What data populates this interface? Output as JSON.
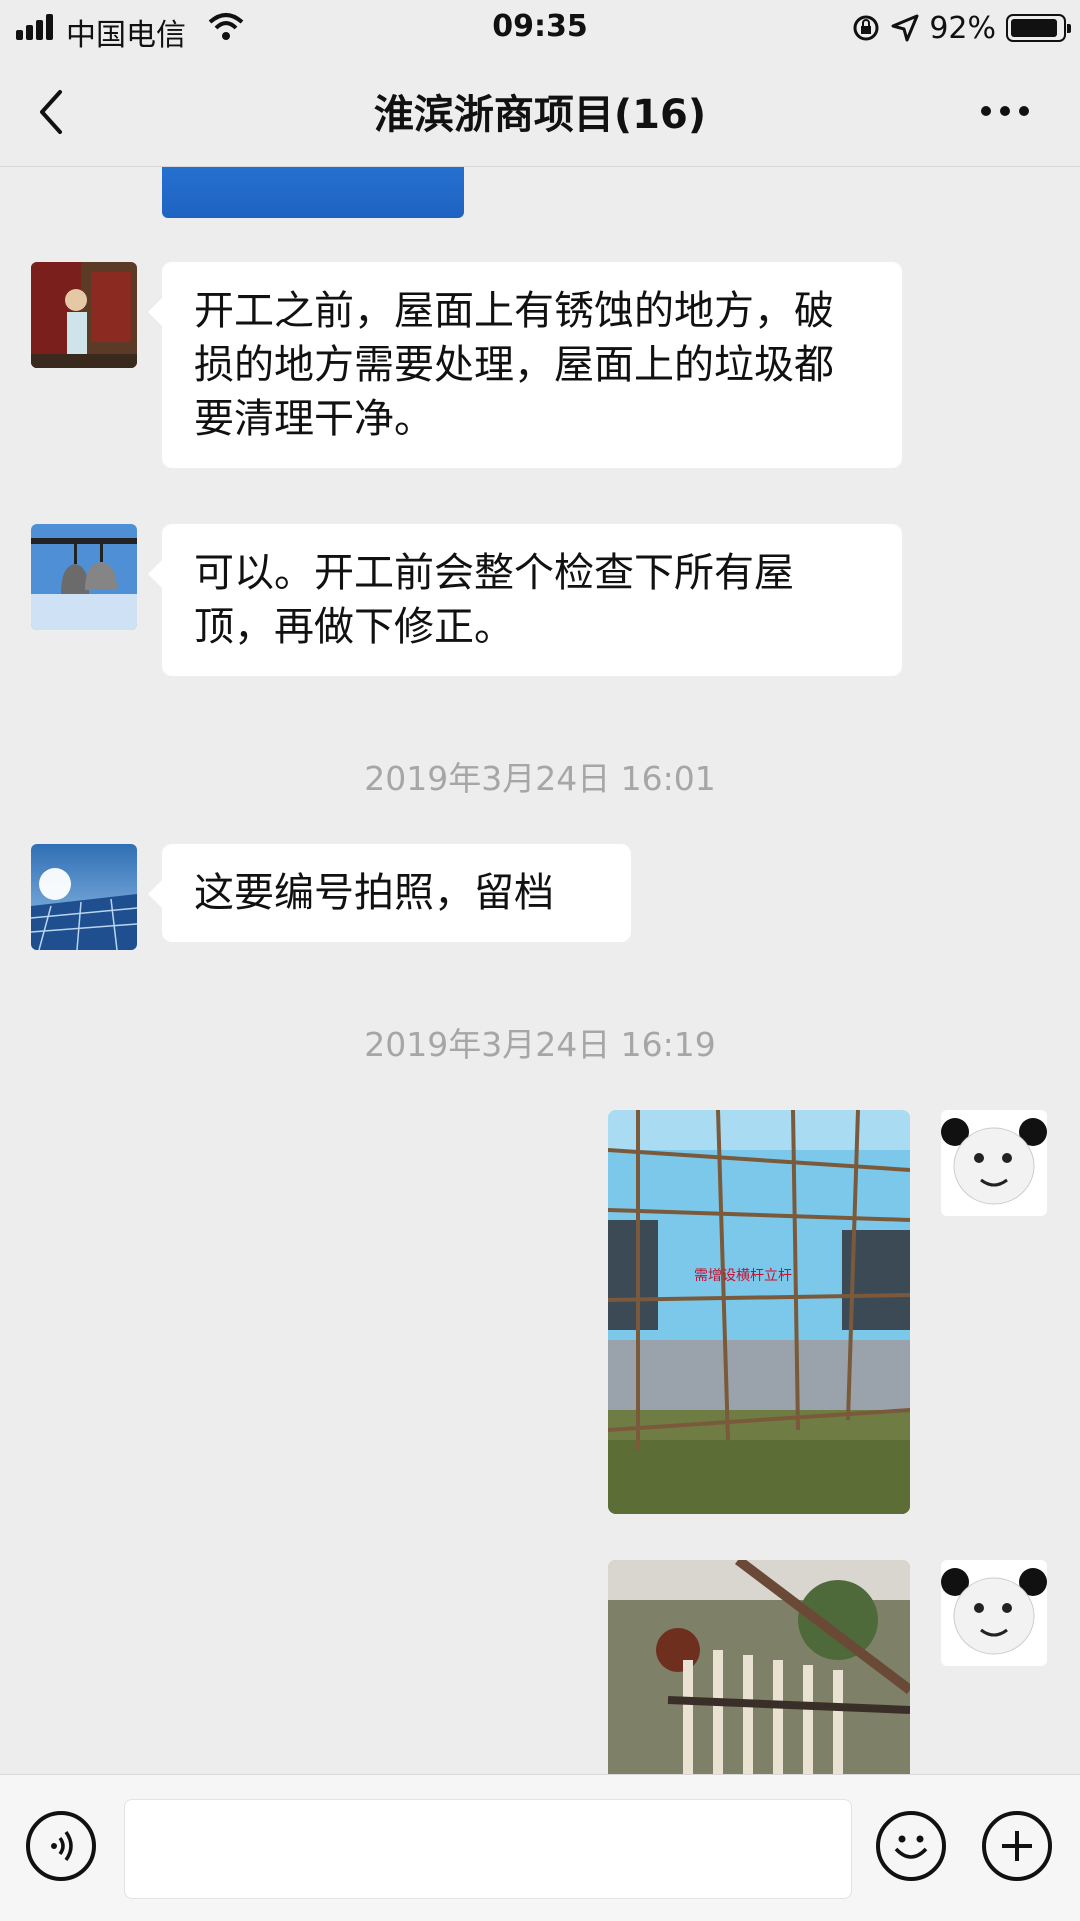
{
  "status_bar": {
    "carrier": "中国电信",
    "time": "09:35",
    "battery_percent": "92%",
    "battery_level": 0.92
  },
  "nav": {
    "title": "淮滨浙商项目(16)"
  },
  "messages": [
    {
      "type": "text",
      "side": "left",
      "text": "开工之前，屋面上有锈蚀的地方，破损的地方需要处理，屋面上的垃圾都要清理干净。"
    },
    {
      "type": "text",
      "side": "left",
      "text": "可以。开工前会整个检查下所有屋顶，再做下修正。"
    },
    {
      "type": "timestamp",
      "text": "2019年3月24日 16:01"
    },
    {
      "type": "text",
      "side": "left",
      "text": "这要编号拍照，留档"
    },
    {
      "type": "timestamp",
      "text": "2019年3月24日 16:19"
    },
    {
      "type": "image",
      "side": "right",
      "caption": "需增设横杆立杆"
    },
    {
      "type": "image",
      "side": "right",
      "caption": ""
    }
  ],
  "input": {
    "placeholder": ""
  },
  "colors": {
    "background": "#ededed",
    "bubble": "#ffffff",
    "timestamp": "#a6a6a6"
  },
  "icons": [
    "signal-icon",
    "wifi-icon",
    "lock-rotation-icon",
    "location-icon",
    "battery-icon",
    "back-icon",
    "more-icon",
    "voice-icon",
    "emoji-icon",
    "add-icon"
  ]
}
